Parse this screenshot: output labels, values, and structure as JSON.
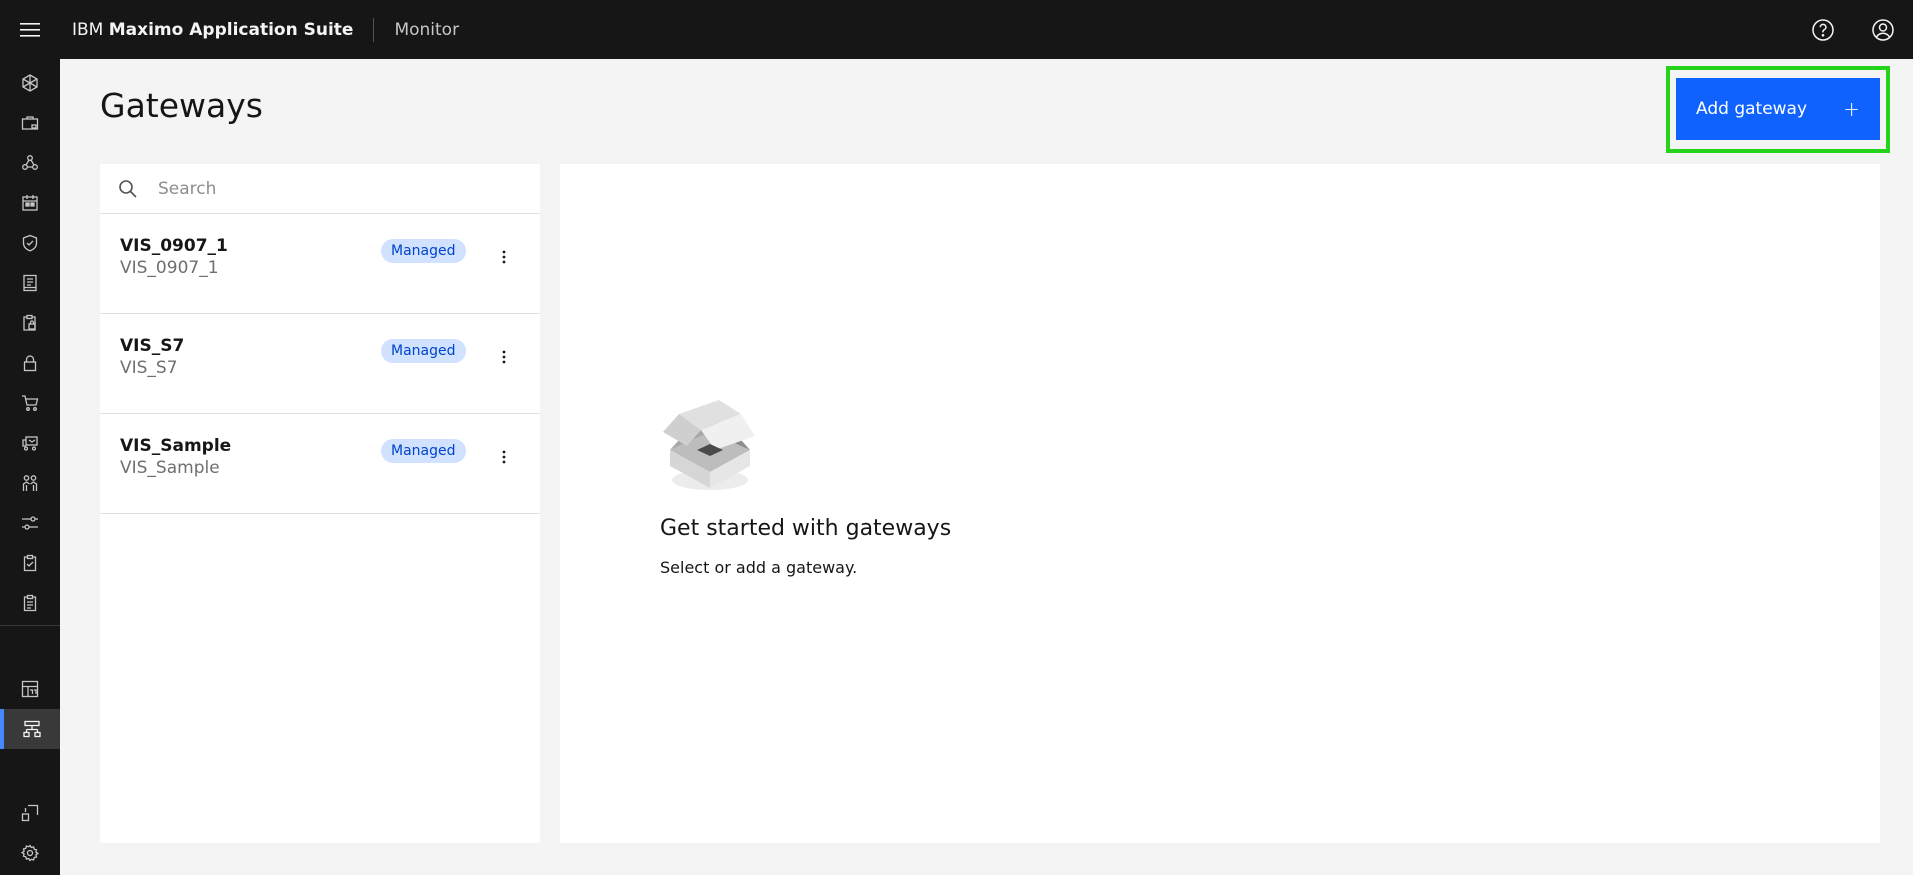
{
  "header": {
    "brand_prefix": "IBM",
    "brand_name": "Maximo Application Suite",
    "module": "Monitor"
  },
  "page": {
    "title": "Gateways",
    "add_button_label": "Add gateway",
    "add_button_icon": "+"
  },
  "search": {
    "placeholder": "Search",
    "value": ""
  },
  "gateways": [
    {
      "name": "VIS_0907_1",
      "id": "VIS_0907_1",
      "status": "Managed"
    },
    {
      "name": "VIS_S7",
      "id": "VIS_S7",
      "status": "Managed"
    },
    {
      "name": "VIS_Sample",
      "id": "VIS_Sample",
      "status": "Managed"
    }
  ],
  "empty_state": {
    "title": "Get started with gateways",
    "subtitle": "Select or add a gateway."
  },
  "colors": {
    "header_bg": "#161616",
    "primary_button": "#0f62fe",
    "highlight_outline": "#24d31a",
    "tag_bg": "#d0e2ff",
    "tag_text": "#0043ce",
    "active_nav_indicator": "#4589ff"
  }
}
